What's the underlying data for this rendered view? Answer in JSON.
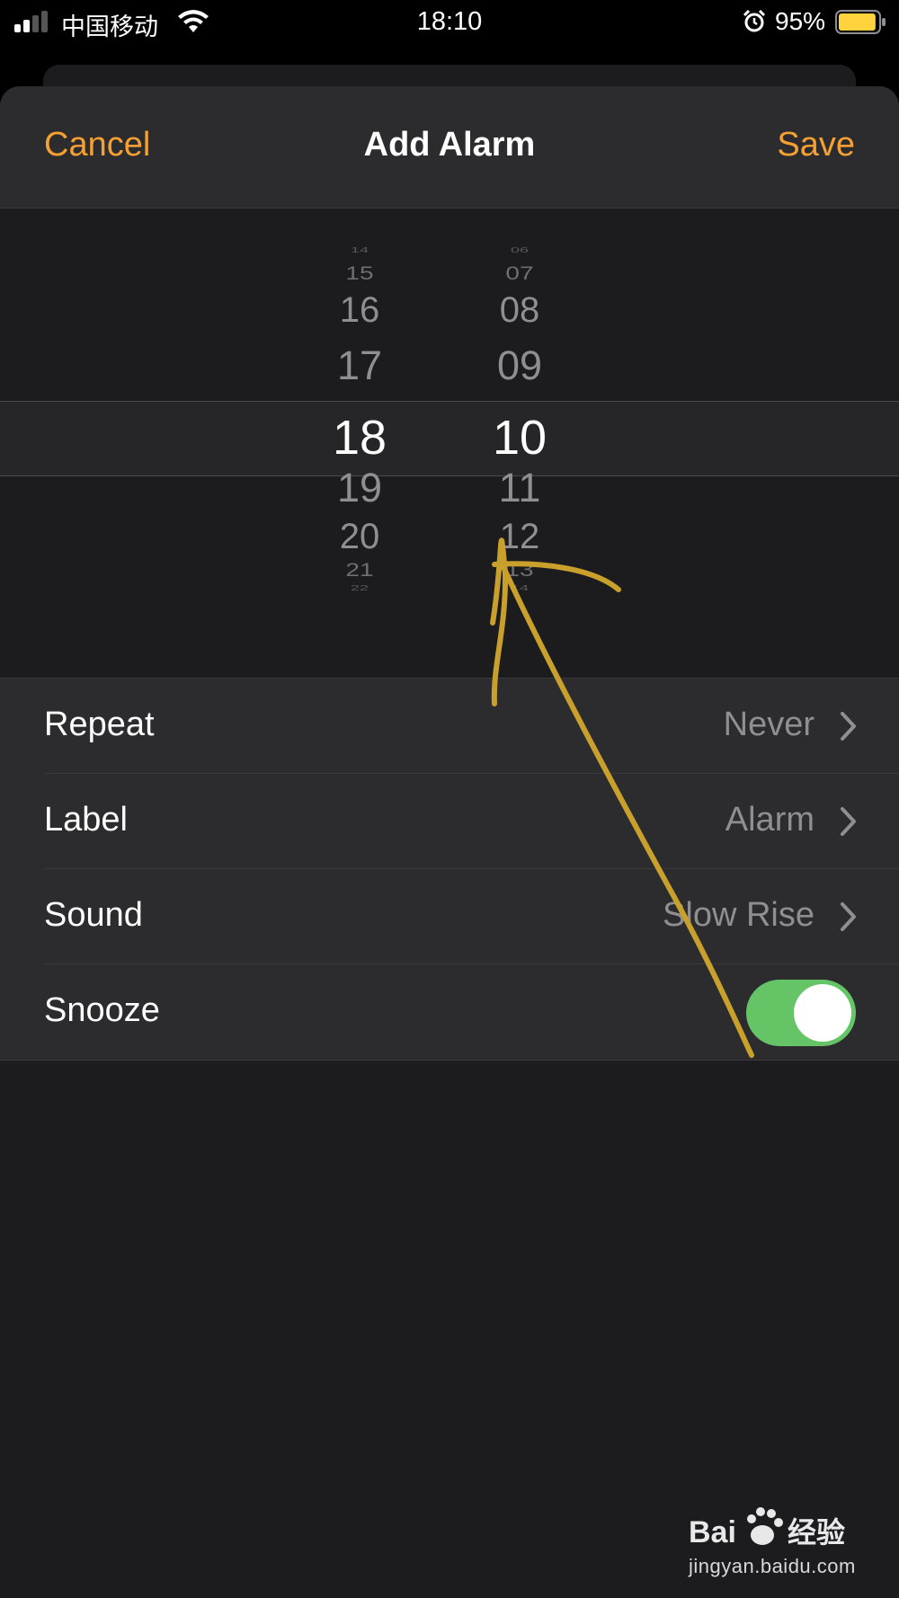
{
  "status_bar": {
    "carrier": "中国移动",
    "time": "18:10",
    "battery_percent": "95%",
    "battery_level": 0.95,
    "signal_bars_filled": 2,
    "signal_bars_total": 4,
    "icons": [
      "signal-icon",
      "wifi-icon",
      "alarm-icon",
      "battery-icon"
    ]
  },
  "nav": {
    "cancel_label": "Cancel",
    "title": "Add Alarm",
    "save_label": "Save"
  },
  "picker": {
    "hours": [
      "14",
      "15",
      "16",
      "17",
      "18",
      "19",
      "20",
      "21",
      "22"
    ],
    "minutes": [
      "06",
      "07",
      "08",
      "09",
      "10",
      "11",
      "12",
      "13",
      "14"
    ],
    "selected_hour": "18",
    "selected_minute": "10"
  },
  "settings": {
    "repeat": {
      "label": "Repeat",
      "value": "Never"
    },
    "label": {
      "label": "Label",
      "value": "Alarm"
    },
    "sound": {
      "label": "Sound",
      "value": "Slow Rise"
    },
    "snooze": {
      "label": "Snooze",
      "enabled": true
    }
  },
  "colors": {
    "accent": "#f5a033",
    "toggle_on": "#65c466",
    "annotation": "#c9a02c",
    "sheet_bg": "#1c1c1e",
    "row_bg": "#2c2c2e"
  },
  "watermark": {
    "logo_text": "Bai  经验",
    "url": "jingyan.baidu.com"
  }
}
